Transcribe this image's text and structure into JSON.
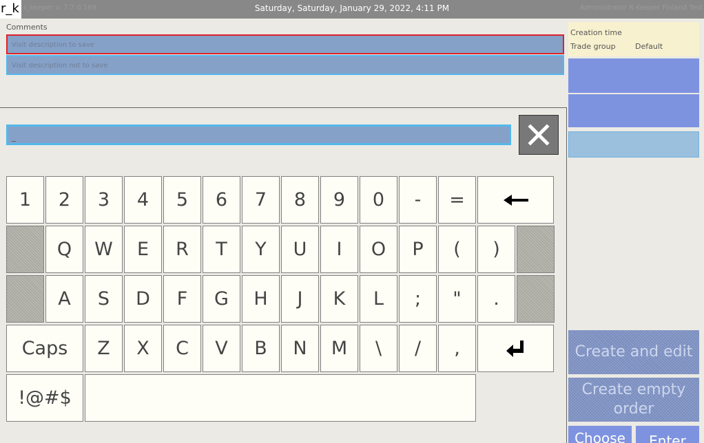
{
  "header": {
    "logo": "r_k",
    "version": "r_keeper v. 7.7.0.169",
    "datetime": "Saturday, Saturday, January 29, 2022, 4:11 PM",
    "user": "Administrator R-Keeper Finland Test"
  },
  "comments": {
    "label": "Comments",
    "field_save_placeholder": "Visit description to save",
    "field_nosave_placeholder": "Visit description not to save"
  },
  "info": {
    "creation_time_label": "Creation time",
    "creation_time_value": "",
    "trade_group_label": "Trade group",
    "trade_group_value": "Default"
  },
  "actions": {
    "create_and_edit": "Create and edit",
    "create_empty_order": "Create empty order",
    "choose": "Choose",
    "enter": "Enter"
  },
  "keyboard": {
    "input_value": "_",
    "rows": [
      [
        "1",
        "2",
        "3",
        "4",
        "5",
        "6",
        "7",
        "8",
        "9",
        "0",
        "-",
        "="
      ],
      [
        "Q",
        "W",
        "E",
        "R",
        "T",
        "Y",
        "U",
        "I",
        "O",
        "P",
        "(",
        ")"
      ],
      [
        "A",
        "S",
        "D",
        "F",
        "G",
        "H",
        "J",
        "K",
        "L",
        ";",
        "\"",
        "."
      ],
      [
        "Z",
        "X",
        "C",
        "V",
        "B",
        "N",
        "M",
        "\\",
        "/",
        ","
      ]
    ],
    "caps_label": "Caps",
    "symbols_label": "!@#$"
  },
  "colors": {
    "accent_blue": "#54b8ec",
    "error_red": "#e0202a",
    "field_bg": "#86a1c7",
    "key_bg": "#fefef6"
  }
}
